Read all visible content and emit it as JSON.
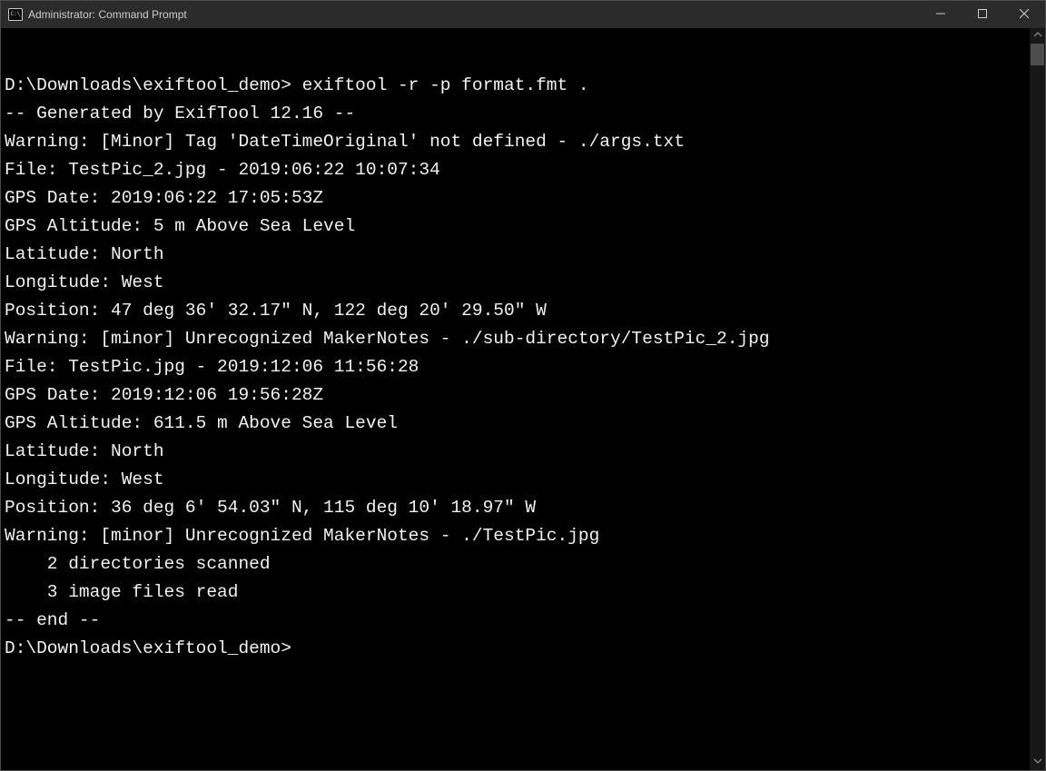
{
  "titlebar": {
    "title": "Administrator: Command Prompt"
  },
  "terminal": {
    "prompt1": "D:\\Downloads\\exiftool_demo> ",
    "command": "exiftool -r -p format.fmt .",
    "lines": [
      "-- Generated by ExifTool 12.16 --",
      "",
      "Warning: [Minor] Tag 'DateTimeOriginal' not defined - ./args.txt",
      "File: TestPic_2.jpg - 2019:06:22 10:07:34",
      "GPS Date: 2019:06:22 17:05:53Z",
      "GPS Altitude: 5 m Above Sea Level",
      "Latitude: North",
      "Longitude: West",
      "Position: 47 deg 36' 32.17\" N, 122 deg 20' 29.50\" W",
      "",
      "Warning: [minor] Unrecognized MakerNotes - ./sub-directory/TestPic_2.jpg",
      "File: TestPic.jpg - 2019:12:06 11:56:28",
      "GPS Date: 2019:12:06 19:56:28Z",
      "GPS Altitude: 611.5 m Above Sea Level",
      "Latitude: North",
      "Longitude: West",
      "Position: 36 deg 6' 54.03\" N, 115 deg 10' 18.97\" W",
      "",
      "Warning: [minor] Unrecognized MakerNotes - ./TestPic.jpg",
      "    2 directories scanned",
      "    3 image files read",
      "-- end --"
    ],
    "prompt2": "D:\\Downloads\\exiftool_demo>"
  }
}
